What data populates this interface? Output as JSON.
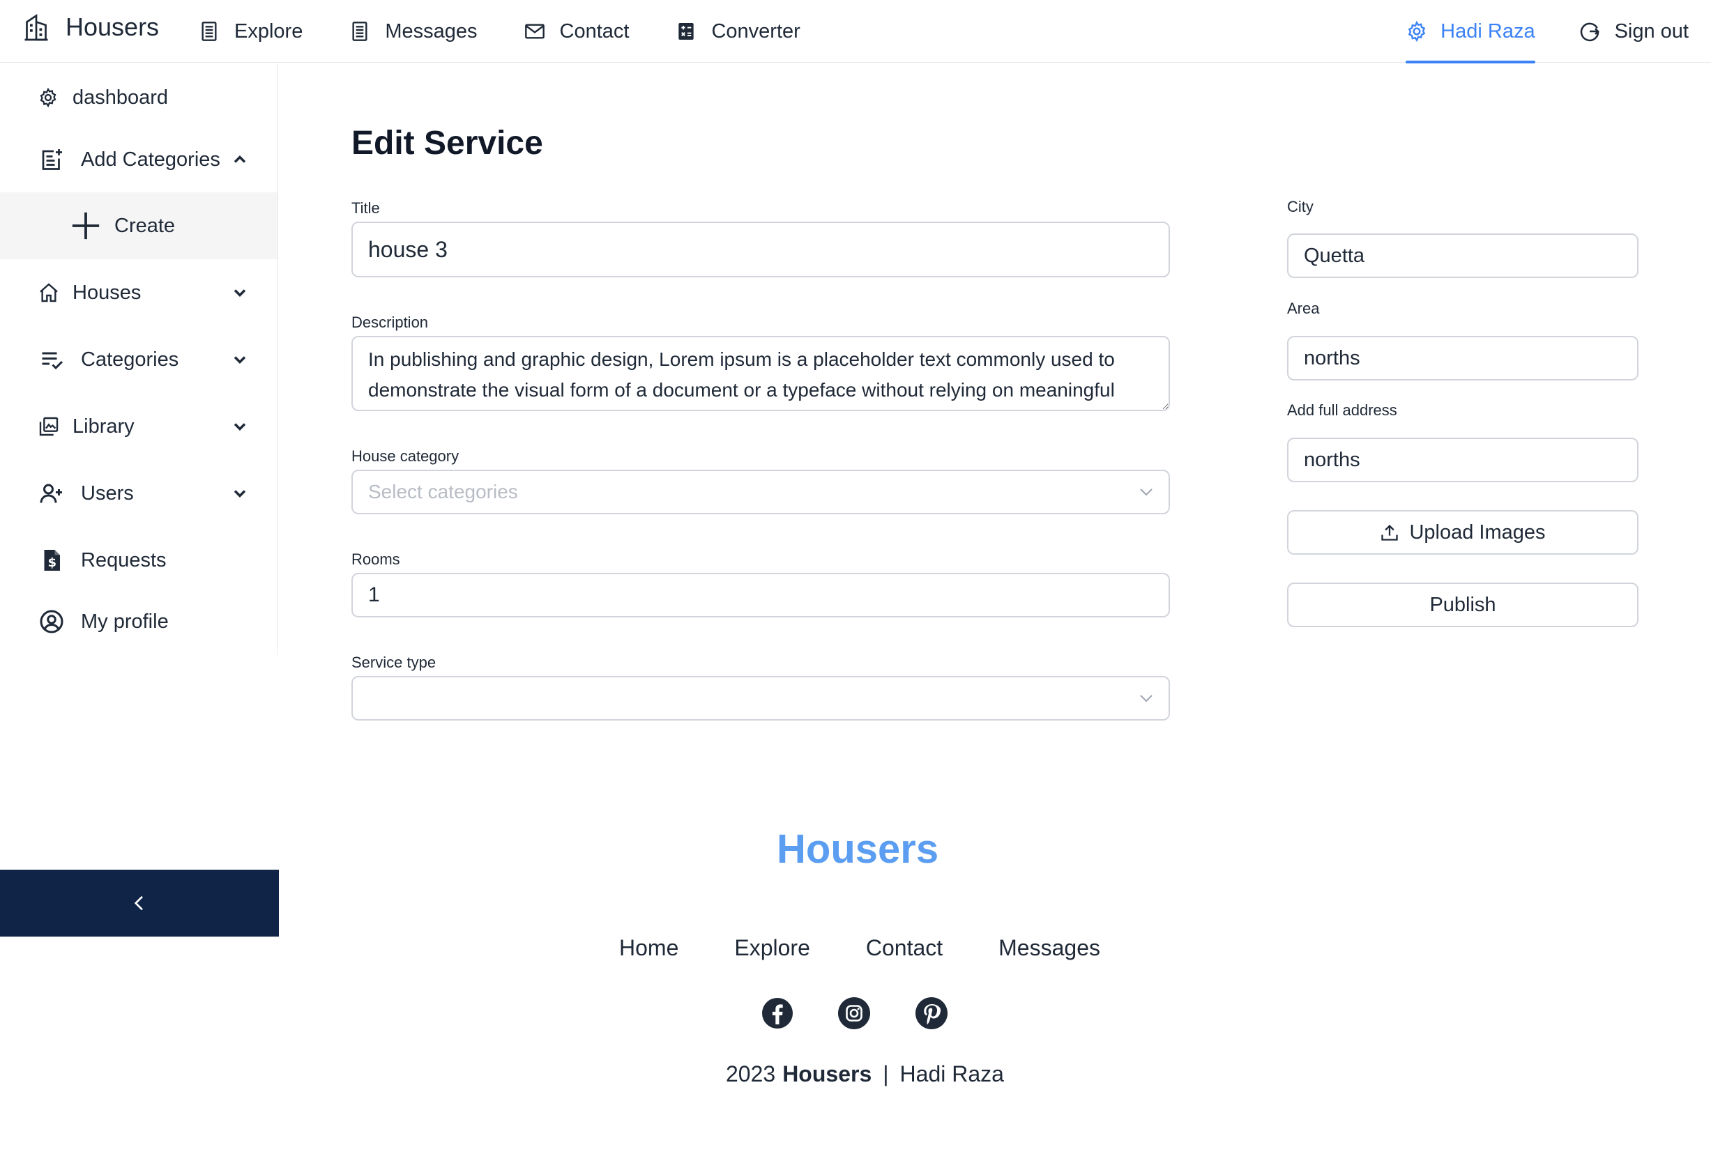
{
  "brand": {
    "name": "Housers",
    "icon": "building-icon"
  },
  "topnav": {
    "items": [
      {
        "label": "Explore",
        "icon": "list-icon"
      },
      {
        "label": "Messages",
        "icon": "list-icon"
      },
      {
        "label": "Contact",
        "icon": "mail-icon"
      },
      {
        "label": "Converter",
        "icon": "calculator-icon"
      }
    ],
    "user": {
      "label": "Hadi Raza",
      "icon": "gear-icon",
      "color": "#3b82f6"
    },
    "signout": {
      "label": "Sign out",
      "icon": "signout-icon"
    }
  },
  "sidebar": {
    "items": [
      {
        "label": "dashboard",
        "icon": "gear-icon"
      },
      {
        "label": "Add Categories",
        "icon": "add-note-icon",
        "expanded": true
      },
      {
        "label": "Create",
        "icon": "plus-icon"
      },
      {
        "label": "Houses",
        "icon": "home-icon"
      },
      {
        "label": "Categories",
        "icon": "checklist-icon"
      },
      {
        "label": "Library",
        "icon": "library-icon"
      },
      {
        "label": "Users",
        "icon": "add-user-icon"
      },
      {
        "label": "Requests",
        "icon": "dollar-file-icon"
      },
      {
        "label": "My profile",
        "icon": "user-circle-icon"
      }
    ],
    "collapse_icon": "chevron-left-icon",
    "collapse_color": "#0f2446"
  },
  "form": {
    "heading": "Edit Service",
    "title": {
      "label": "Title",
      "value": "house 3"
    },
    "description": {
      "label": "Description",
      "value": "In publishing and graphic design, Lorem ipsum is a placeholder text commonly used to demonstrate the visual form of a document or a typeface without relying on meaningful"
    },
    "house_category": {
      "label": "House category",
      "placeholder": "Select categories"
    },
    "rooms": {
      "label": "Rooms",
      "value": "1"
    },
    "service_type": {
      "label": "Service type",
      "value": ""
    },
    "city": {
      "label": "City",
      "value": "Quetta"
    },
    "area": {
      "label": "Area",
      "value": "norths"
    },
    "address": {
      "label": "Add full address",
      "value": "norths"
    },
    "upload_label": "Upload Images",
    "publish_label": "Publish"
  },
  "footer": {
    "brand": "Housers",
    "brand_color": "#5b9ef1",
    "links": [
      "Home",
      "Explore",
      "Contact",
      "Messages"
    ],
    "social": [
      "facebook-icon",
      "instagram-icon",
      "pinterest-icon"
    ],
    "copyright_year": "2023",
    "copyright_brand": "Housers",
    "copyright_sep": "|",
    "copyright_author": "Hadi Raza"
  }
}
